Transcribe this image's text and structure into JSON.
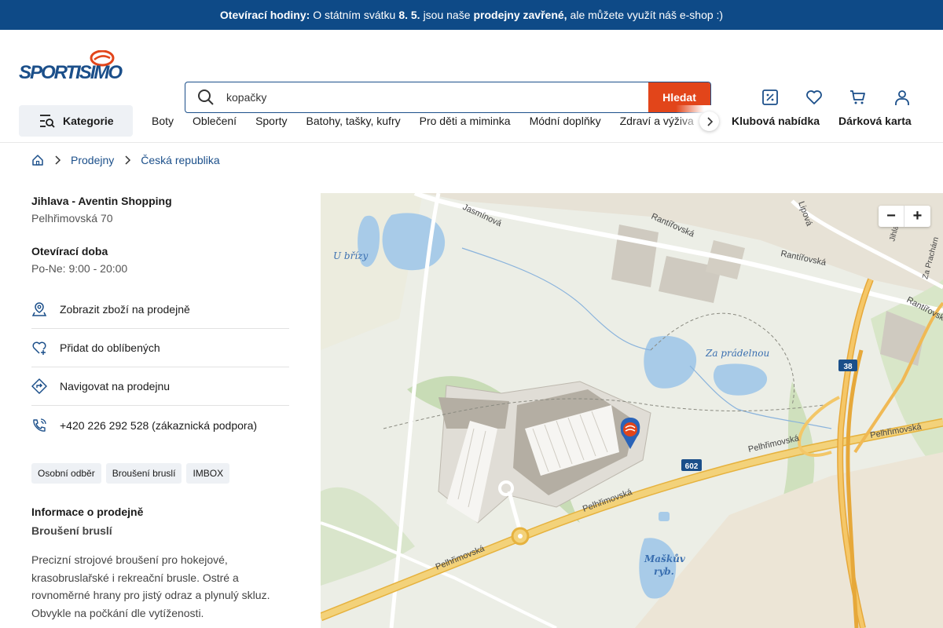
{
  "announcement": {
    "lead": "Otevírací hodiny:",
    "part1": "O státním svátku",
    "date": "8. 5.",
    "part2": "jsou naše",
    "closed": "prodejny zavřené,",
    "part3": "ale můžete využít náš e-shop :)"
  },
  "header": {
    "logo_text": "SPORTISIMO",
    "search_value": "kopačky",
    "search_button": "Hledat",
    "icons": [
      "discount-icon",
      "heart-icon",
      "cart-icon",
      "user-icon"
    ]
  },
  "nav": {
    "categories_label": "Kategorie",
    "items": [
      "Boty",
      "Oblečení",
      "Sporty",
      "Batohy, tašky, kufry",
      "Pro děti a miminka",
      "Módní doplňky",
      "Zdraví a výživa"
    ],
    "right": [
      "Klubová nabídka",
      "Dárková karta"
    ]
  },
  "breadcrumbs": [
    "Prodejny",
    "Česká republika"
  ],
  "store": {
    "name": "Jihlava - Aventin Shopping",
    "address": "Pelhřimovská 70",
    "hours_title": "Otevírací doba",
    "hours": "Po-Ne: 9:00 - 20:00",
    "actions": [
      {
        "label": "Zobrazit zboží na prodejně",
        "icon": "store-pin-icon"
      },
      {
        "label": "Přidat do oblíbených",
        "icon": "heart-plus-icon"
      },
      {
        "label": "Navigovat na prodejnu",
        "icon": "directions-icon"
      },
      {
        "label": "+420 226 292 528 (zákaznická podpora)",
        "icon": "phone-icon"
      }
    ],
    "tags": [
      "Osobní odběr",
      "Broušení bruslí",
      "IMBOX"
    ],
    "info_title": "Informace o prodejně",
    "info_subtitle": "Broušení bruslí",
    "description": "Precizní strojové broušení pro hokejové, krasobruslařské i rekreační brusle. Ostré a rovnoměrné hrany pro jistý odraz a plynulý skluz. Obvykle na počkání dle vytíženosti."
  },
  "map": {
    "labels": {
      "u_brizy": "U břízy",
      "za_pradelnou": "Za prádelnou",
      "maskuv": "Maškův",
      "ryb": "ryb.",
      "jasminova": "Jasmínová",
      "rantirovska1": "Rantířovská",
      "rantirovska2": "Rantířovská",
      "rantirovska3": "Rantířovská",
      "lipova": "Lipová",
      "pelhrimovska1": "Pelhřimovská",
      "pelhrimovska2": "Pelhřimovská",
      "pelhrimovska3": "Pelhřimovská",
      "pelhrimovska4": "Pelhřimovská",
      "road38": "38",
      "road602": "602",
      "za_prachar": "Za Prachárn",
      "jihla": "Jihla"
    },
    "zoom_out": "−",
    "zoom_in": "+"
  },
  "colors": {
    "announcement_bg": "#0e4a87",
    "brand_blue": "#1b4f8a",
    "brand_red": "#e2451a",
    "map_land": "#eceee6",
    "map_water": "#a8cbe8",
    "map_road": "#f3c75a"
  }
}
